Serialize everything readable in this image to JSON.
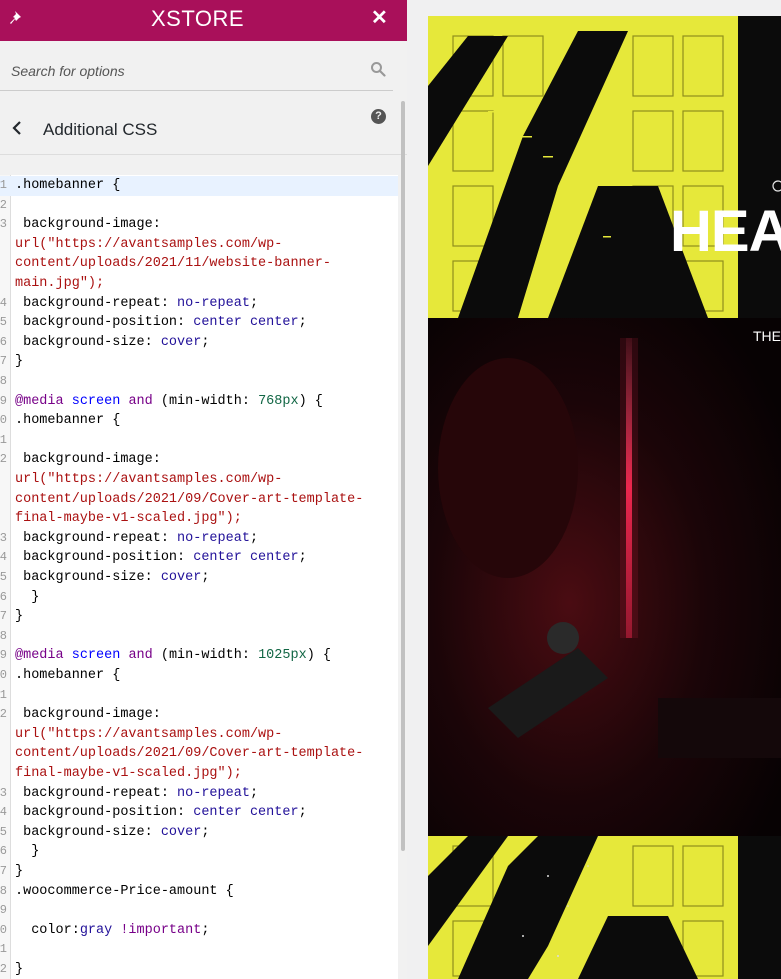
{
  "header": {
    "logo": "XSTORE",
    "pin_icon": "pin-icon",
    "close_icon": "close-icon",
    "close_symbol": "✕",
    "brand_color": "#a9105a"
  },
  "search": {
    "placeholder": "Search for options",
    "icon": "search-icon"
  },
  "section": {
    "back_icon": "chevron-left-icon",
    "title": "Additional CSS",
    "help_icon": "question-mark-icon",
    "help_symbol": "?"
  },
  "editor": {
    "lines": [
      {
        "num": "1",
        "text": ".homebanner {"
      },
      {
        "num": "2",
        "text": ""
      },
      {
        "num": "3",
        "text": " background-image:"
      },
      {
        "num": "",
        "text": "url(\"https://avantsamples.com/wp-"
      },
      {
        "num": "",
        "text": "content/uploads/2021/11/website-banner-"
      },
      {
        "num": "",
        "text": "main.jpg\");"
      },
      {
        "num": "4",
        "text": " background-repeat: no-repeat;"
      },
      {
        "num": "5",
        "text": " background-position: center center;"
      },
      {
        "num": "6",
        "text": " background-size: cover;"
      },
      {
        "num": "7",
        "text": "}"
      },
      {
        "num": "8",
        "text": ""
      },
      {
        "num": "9",
        "text": "@media screen and (min-width: 768px) {"
      },
      {
        "num": "0",
        "text": ".homebanner {"
      },
      {
        "num": "1",
        "text": ""
      },
      {
        "num": "2",
        "text": " background-image:"
      },
      {
        "num": "",
        "text": "url(\"https://avantsamples.com/wp-"
      },
      {
        "num": "",
        "text": "content/uploads/2021/09/Cover-art-template-"
      },
      {
        "num": "",
        "text": "final-maybe-v1-scaled.jpg\");"
      },
      {
        "num": "3",
        "text": " background-repeat: no-repeat;"
      },
      {
        "num": "4",
        "text": " background-position: center center;"
      },
      {
        "num": "5",
        "text": " background-size: cover;"
      },
      {
        "num": "6",
        "text": "  }"
      },
      {
        "num": "7",
        "text": "}"
      },
      {
        "num": "8",
        "text": ""
      },
      {
        "num": "9",
        "text": "@media screen and (min-width: 1025px) {"
      },
      {
        "num": "0",
        "text": ".homebanner {"
      },
      {
        "num": "1",
        "text": ""
      },
      {
        "num": "2",
        "text": " background-image:"
      },
      {
        "num": "",
        "text": "url(\"https://avantsamples.com/wp-"
      },
      {
        "num": "",
        "text": "content/uploads/2021/09/Cover-art-template-"
      },
      {
        "num": "",
        "text": "final-maybe-v1-scaled.jpg\");"
      },
      {
        "num": "3",
        "text": " background-repeat: no-repeat;"
      },
      {
        "num": "4",
        "text": " background-position: center center;"
      },
      {
        "num": "5",
        "text": " background-size: cover;"
      },
      {
        "num": "6",
        "text": "  }"
      },
      {
        "num": "7",
        "text": "}"
      },
      {
        "num": "8",
        "text": ".woocommerce-Price-amount {"
      },
      {
        "num": "9",
        "text": ""
      },
      {
        "num": "0",
        "text": "  color:gray !important;"
      },
      {
        "num": "1",
        "text": ""
      },
      {
        "num": "2",
        "text": "}"
      }
    ]
  },
  "preview": {
    "hero_heading": "HEAV",
    "hero_subtext": "THE",
    "accent_yellow": "#e6e83a"
  }
}
